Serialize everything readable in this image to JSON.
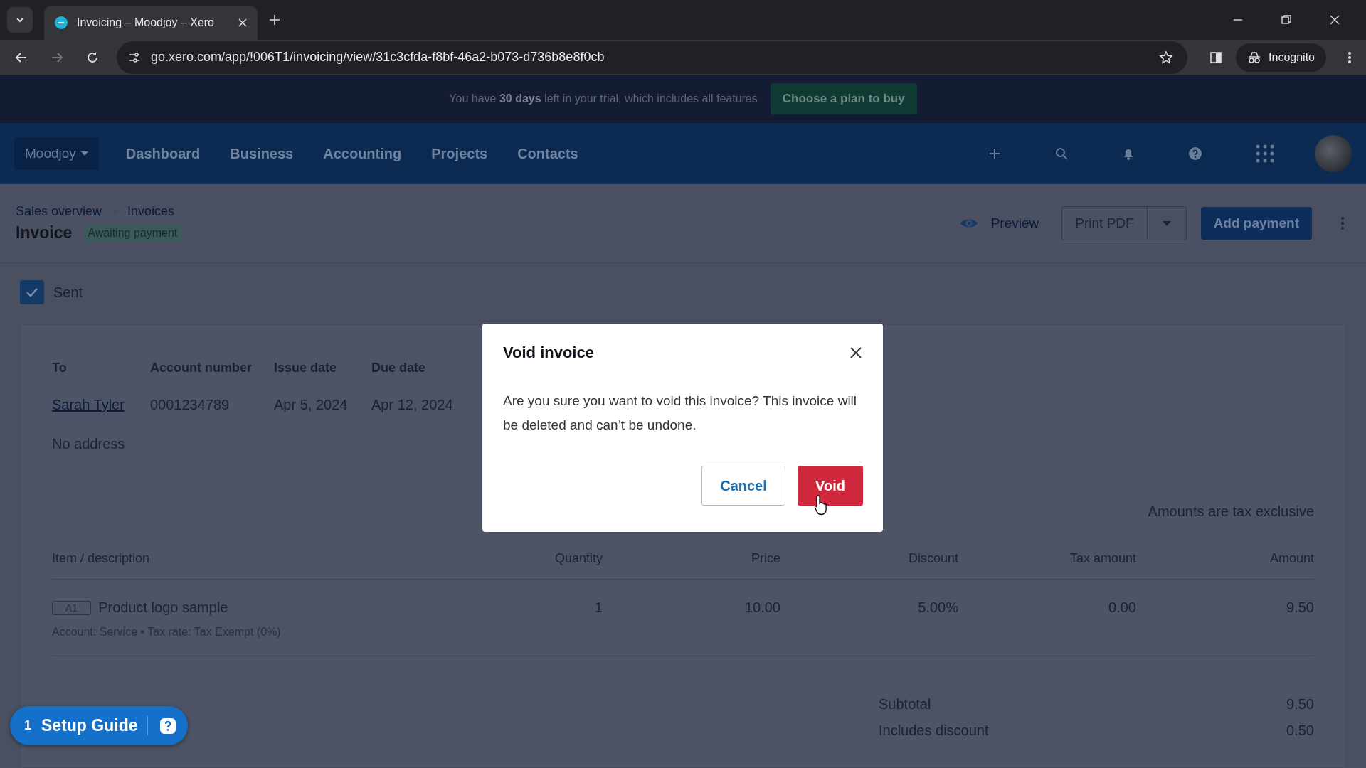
{
  "browser": {
    "tab_title": "Invoicing – Moodjoy – Xero",
    "url": "go.xero.com/app/!006T1/invoicing/view/31c3cfda-f8bf-46a2-b073-d736b8e8f0cb",
    "profile": "Incognito"
  },
  "trial_banner": {
    "text": "You have **30 days** left in your trial, which includes all features",
    "button": "Choose a plan to buy"
  },
  "nav": {
    "org": "Moodjoy",
    "items": [
      "Dashboard",
      "Business",
      "Accounting",
      "Projects",
      "Contacts"
    ]
  },
  "breadcrumbs": [
    "Sales overview",
    "Invoices"
  ],
  "title": "Invoice",
  "status": "Awaiting payment",
  "actions": {
    "preview": "Preview",
    "print": "Print PDF",
    "primary": "Add payment"
  },
  "sent": {
    "label": "Sent",
    "checked": true
  },
  "details": {
    "columns": [
      {
        "heading": "To",
        "value": "Sarah Tyler",
        "kind": "link"
      },
      {
        "heading": "Account number",
        "value": "0001234789",
        "kind": "text"
      },
      {
        "heading": "Issue date",
        "value": "Apr 5, 2024",
        "kind": "text"
      },
      {
        "heading": "Due date",
        "value": "Apr 12, 2024",
        "kind": "text"
      }
    ],
    "address": "No address"
  },
  "tax_note": "Amounts are tax exclusive",
  "items": {
    "columns": [
      "Item / description",
      "Quantity",
      "Price",
      "Discount",
      "Tax amount",
      "Amount"
    ],
    "rows": [
      {
        "code": "A1",
        "cells": [
          "Product logo sample",
          "1",
          "10.00",
          "5.00%",
          "0.00",
          "9.50"
        ],
        "meta": "Account: Service • Tax rate: Tax Exempt (0%)"
      }
    ]
  },
  "totals": [
    {
      "label": "Subtotal",
      "value": "9.50"
    },
    {
      "label": "Includes discount",
      "value": "0.50"
    }
  ],
  "setup_guide": {
    "count": "1",
    "label": "Setup Guide"
  },
  "dialog": {
    "title": "Void invoice",
    "message": "Are you sure you want to void this invoice? This invoice will be deleted and can’t be undone.",
    "cancel": "Cancel",
    "confirm": "Void"
  }
}
